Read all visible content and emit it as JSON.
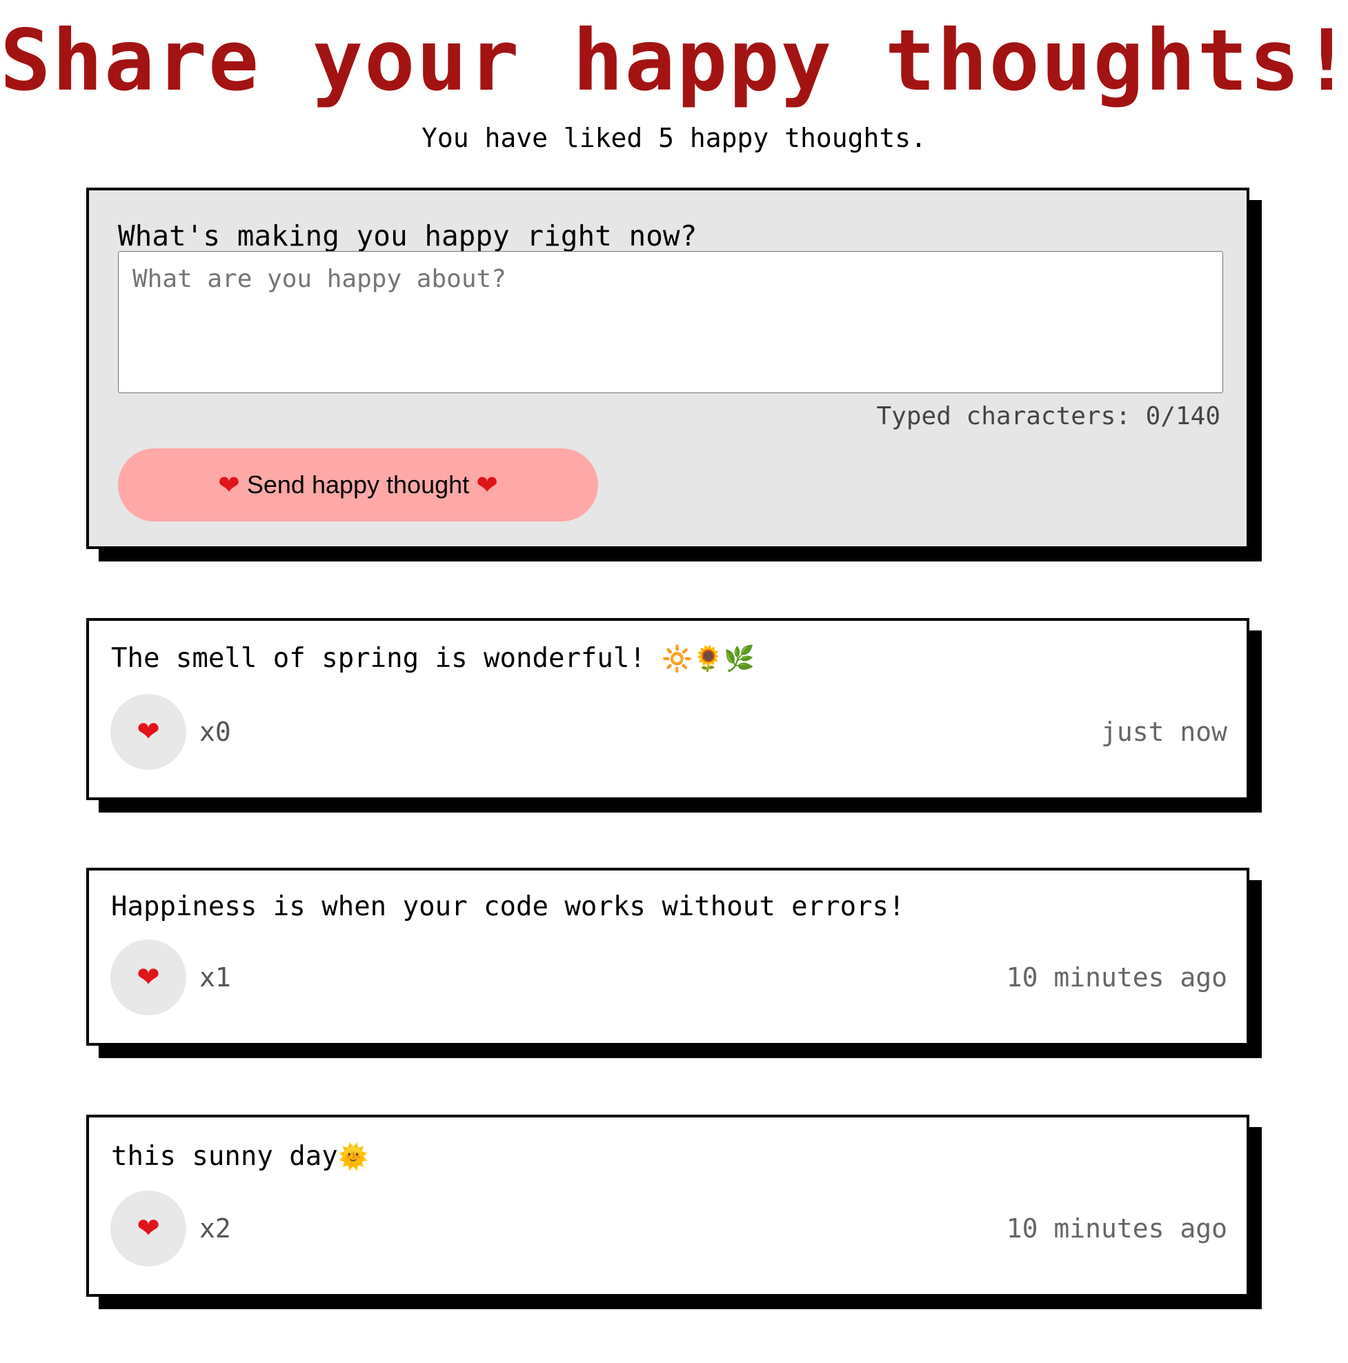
{
  "header": {
    "title": "Share your happy thoughts!",
    "liked_text": "You have liked 5 happy thoughts."
  },
  "form": {
    "question": "What's making you happy right now?",
    "placeholder": "What are you happy about?",
    "value": "",
    "char_counter": "Typed characters: 0/140",
    "send_label": "Send happy thought"
  },
  "icons": {
    "heart": "❤",
    "heart_icon_name": "heart-icon"
  },
  "colors": {
    "title": "#a31313",
    "send_button": "#ffa8a8",
    "form_background": "#e6e6e6",
    "heart": "#e0141b"
  },
  "thoughts": [
    {
      "text": "The smell of spring is wonderful!",
      "emoji": "🔆🌻🌿",
      "likes": "x0",
      "time": "just now"
    },
    {
      "text": "Happiness is when your code works without errors!",
      "emoji": "",
      "likes": "x1",
      "time": "10 minutes ago"
    },
    {
      "text": "this sunny day",
      "emoji": "🌞",
      "likes": "x2",
      "time": "10 minutes ago"
    }
  ]
}
